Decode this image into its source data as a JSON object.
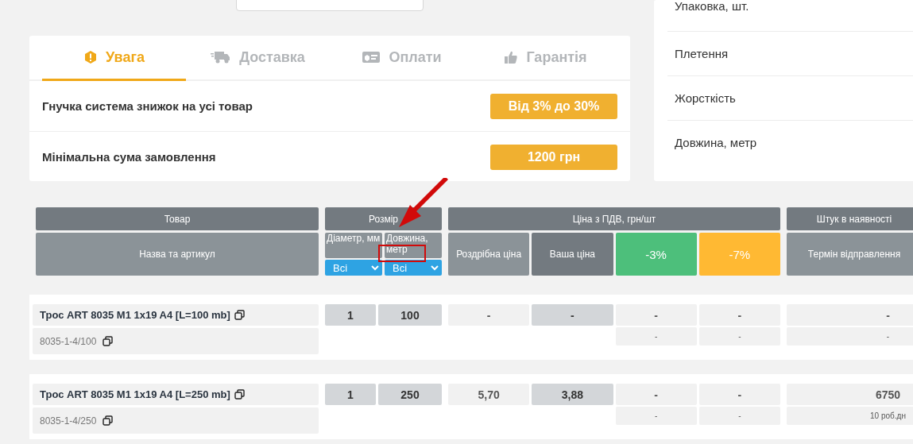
{
  "tabs": [
    {
      "label": "Увага",
      "selected": true
    },
    {
      "label": "Доставка",
      "selected": false
    },
    {
      "label": "Оплати",
      "selected": false
    },
    {
      "label": "Гарантія",
      "selected": false
    }
  ],
  "info_rows": [
    {
      "label": "Гнучка система знижок на усі товар",
      "badge": "Від 3% до 30%"
    },
    {
      "label": "Мінімальна сума замовлення",
      "badge": "1200 грн"
    }
  ],
  "specs": [
    "Упаковка, шт.",
    "Плетення",
    "Жорсткість",
    "Довжина, метр"
  ],
  "table": {
    "groups": [
      "Товар",
      "Розмір",
      "Ціна з ПДВ, грн/шт",
      "Штук в наявності"
    ],
    "name_column": "Назва та артикул",
    "size_columns": [
      {
        "label": "Діаметр, мм",
        "filter": "Всі"
      },
      {
        "label": "Довжина, метр",
        "filter": "Всі"
      }
    ],
    "price_columns": [
      {
        "label": "Роздрібна ціна",
        "kind": "plain"
      },
      {
        "label": "Ваша ціна",
        "kind": "dark"
      },
      {
        "label": "-3%",
        "kind": "discount",
        "color": "#4dbf7b"
      },
      {
        "label": "-7%",
        "kind": "discount",
        "color": "#ffb933"
      }
    ],
    "stock_column": "Термін відправлення",
    "rows": [
      {
        "name": "Трос ART 8035 M1 1x19 A4 [L=100 mb]",
        "article": "8035-1-4/100",
        "diameter": "1",
        "length": "100",
        "retail": "-",
        "your_price": "-",
        "discounts": [
          {
            "price": "-",
            "note": "-"
          },
          {
            "price": "-",
            "note": "-"
          }
        ],
        "stock": "-",
        "shipping": "-"
      },
      {
        "name": "Трос ART 8035 M1 1x19 A4 [L=250 mb]",
        "article": "8035-1-4/250",
        "diameter": "1",
        "length": "250",
        "retail": "5,70",
        "your_price": "3,88",
        "discounts": [
          {
            "price": "-",
            "note": "-"
          },
          {
            "price": "-",
            "note": "-"
          }
        ],
        "stock": "6750",
        "shipping": "10 роб.дн"
      }
    ]
  }
}
